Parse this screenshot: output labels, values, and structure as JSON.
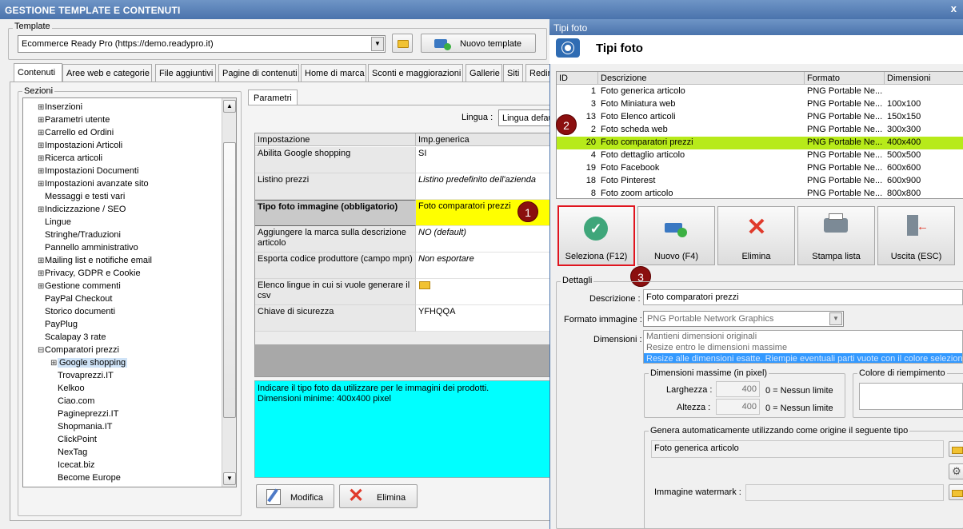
{
  "window": {
    "title": "GESTIONE TEMPLATE E CONTENUTI",
    "close": "x"
  },
  "template": {
    "group_label": "Template",
    "selected": "Ecommerce Ready Pro (https://demo.readypro.it)",
    "new_button": "Nuovo template"
  },
  "tabs": [
    "Contenuti",
    "Aree web e categorie",
    "File aggiuntivi",
    "Pagine di contenuti",
    "Home di marca",
    "Sconti e maggiorazioni",
    "Gallerie",
    "Siti",
    "Redir"
  ],
  "sections": {
    "label": "Sezioni",
    "items": [
      "Inserzioni",
      "Parametri utente",
      "Carrello ed Ordini",
      "Impostazioni Articoli",
      "Ricerca articoli",
      "Impostazioni Documenti",
      "Impostazioni avanzate sito",
      "Messaggi e testi vari",
      "Indicizzazione / SEO",
      "Lingue",
      "Stringhe/Traduzioni",
      "Pannello amministrativo",
      "Mailing list e notifiche email",
      "Privacy, GDPR e Cookie",
      "Gestione commenti",
      "PayPal Checkout",
      "Storico documenti",
      "PayPlug",
      "Scalapay 3 rate",
      "Comparatori prezzi",
      "Google shopping",
      "Trovaprezzi.IT",
      "Kelkoo",
      "Ciao.com",
      "Pagineprezzi.IT",
      "Shopmania.IT",
      "ClickPoint",
      "NexTag",
      "Icecat.biz",
      "Become Europe"
    ]
  },
  "params": {
    "tab": "Parametri",
    "lingua_label": "Lingua :",
    "lingua_value": "Lingua defau",
    "col_setting": "Impostazione",
    "col_value": "Imp.generica",
    "rows": [
      {
        "name": "Abilita Google shopping",
        "value": "SI"
      },
      {
        "name": "Listino prezzi",
        "value": "Listino predefinito dell'azienda"
      },
      {
        "name": "Tipo foto immagine (obbligatorio)",
        "value": "Foto comparatori prezzi"
      },
      {
        "name": "Aggiungere la marca sulla descrizione articolo",
        "value": "NO (default)"
      },
      {
        "name": "Esporta codice produttore (campo mpn)",
        "value": "Non esportare"
      },
      {
        "name": "Elenco lingue in cui si vuole generare il csv",
        "value": ""
      },
      {
        "name": "Chiave di sicurezza",
        "value": "YFHQQA"
      }
    ],
    "description": "Indicare il tipo foto da utilizzare per le immagini dei prodotti.\nDimensioni minime: 400x400 pixel",
    "edit_button": "Modifica",
    "delete_button": "Elimina"
  },
  "dialog": {
    "title": "Tipi foto",
    "heading": "Tipi foto",
    "columns": [
      "ID",
      "Descrizione",
      "Formato",
      "Dimensioni"
    ],
    "rows": [
      {
        "id": "1",
        "desc": "Foto generica articolo",
        "format": "PNG Portable Ne...",
        "dim": ""
      },
      {
        "id": "3",
        "desc": "Foto Miniatura web",
        "format": "PNG Portable Ne...",
        "dim": "100x100"
      },
      {
        "id": "13",
        "desc": "Foto Elenco articoli",
        "format": "PNG Portable Ne...",
        "dim": "150x150"
      },
      {
        "id": "2",
        "desc": "Foto scheda web",
        "format": "PNG Portable Ne...",
        "dim": "300x300"
      },
      {
        "id": "20",
        "desc": "Foto comparatori prezzi",
        "format": "PNG Portable Ne...",
        "dim": "400x400"
      },
      {
        "id": "4",
        "desc": "Foto dettaglio articolo",
        "format": "PNG Portable Ne...",
        "dim": "500x500"
      },
      {
        "id": "19",
        "desc": "Foto Facebook",
        "format": "PNG Portable Ne...",
        "dim": "600x600"
      },
      {
        "id": "18",
        "desc": "Foto Pinterest",
        "format": "PNG Portable Ne...",
        "dim": "600x900"
      },
      {
        "id": "8",
        "desc": "Foto zoom articolo",
        "format": "PNG Portable Ne...",
        "dim": "800x800"
      }
    ],
    "buttons": {
      "select": "Seleziona (F12)",
      "new": "Nuovo (F4)",
      "delete": "Elimina",
      "print": "Stampa lista",
      "exit": "Uscita (ESC)"
    },
    "details": {
      "label": "Dettagli",
      "desc_label": "Descrizione :",
      "desc_value": "Foto comparatori prezzi",
      "format_label": "Formato immagine :",
      "format_value": "PNG Portable Network Graphics",
      "dim_label": "Dimensioni :",
      "dim_options": [
        "Mantieni dimensioni originali",
        "Resize entro le dimensioni massime",
        "Resize alle dimensioni esatte. Riempie eventuali parti vuote con il colore selezionato"
      ],
      "max_label": "Dimensioni massime (in pixel)",
      "width_label": "Larghezza :",
      "width_value": "400",
      "height_label": "Altezza :",
      "height_value": "400",
      "no_limit": "0 = Nessun limite",
      "fill_label": "Colore di riempimento",
      "auto_label": "Genera automaticamente utilizzando come origine il seguente tipo",
      "auto_value": "Foto generica articolo",
      "watermark_label": "Immagine watermark :"
    }
  },
  "markers": [
    "1",
    "2",
    "3"
  ],
  "colors": {
    "highlight_yellow": "#ffff00",
    "selected_row": "#b7ea1a",
    "description_bg": "#00ffff",
    "marker": "#8b0f0f",
    "title_blue": "#4a73ac"
  }
}
